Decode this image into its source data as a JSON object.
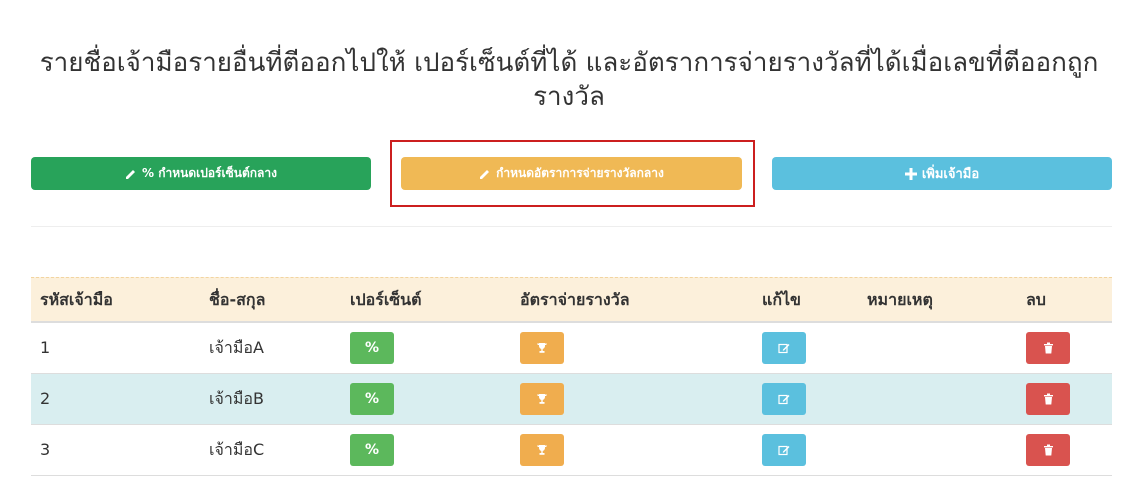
{
  "page": {
    "title": "รายชื่อเจ้ามือรายอื่นที่ตีออกไปให้ เปอร์เซ็นต์ที่ได้ และอัตราการจ่ายรางวัลที่ได้เมื่อเลขที่ตีออกถูกรางวัล"
  },
  "toolbar": {
    "percent_master_label": "% กำหนดเปอร์เซ็นต์กลาง",
    "reward_master_label": "กำหนดอัตราการจ่ายรางวัลกลาง",
    "add_dealer_label": "เพิ่มเจ้ามือ"
  },
  "table": {
    "headers": [
      "รหัสเจ้ามือ",
      "ชื่อ-สกุล",
      "เปอร์เซ็นต์",
      "อัตราจ่ายรางวัล",
      "แก้ไข",
      "หมายเหตุ",
      "ลบ"
    ],
    "rows": [
      {
        "id": "1",
        "name": "เจ้ามือA",
        "percent_label": "%",
        "note": ""
      },
      {
        "id": "2",
        "name": "เจ้ามือB",
        "percent_label": "%",
        "note": ""
      },
      {
        "id": "3",
        "name": "เจ้ามือC",
        "percent_label": "%",
        "note": ""
      }
    ]
  },
  "icons": {
    "pencil": "pencil-icon",
    "plus": "plus-icon",
    "trophy": "trophy-icon",
    "edit": "edit-icon",
    "trash": "trash-icon"
  },
  "colors": {
    "green": "#28a35a",
    "orange": "#f0b955",
    "blue": "#5bc0de",
    "red": "#d9534f",
    "highlight": "#cc1f1f",
    "header_bg": "#fcf0db",
    "stripe": "#d9eef0"
  }
}
